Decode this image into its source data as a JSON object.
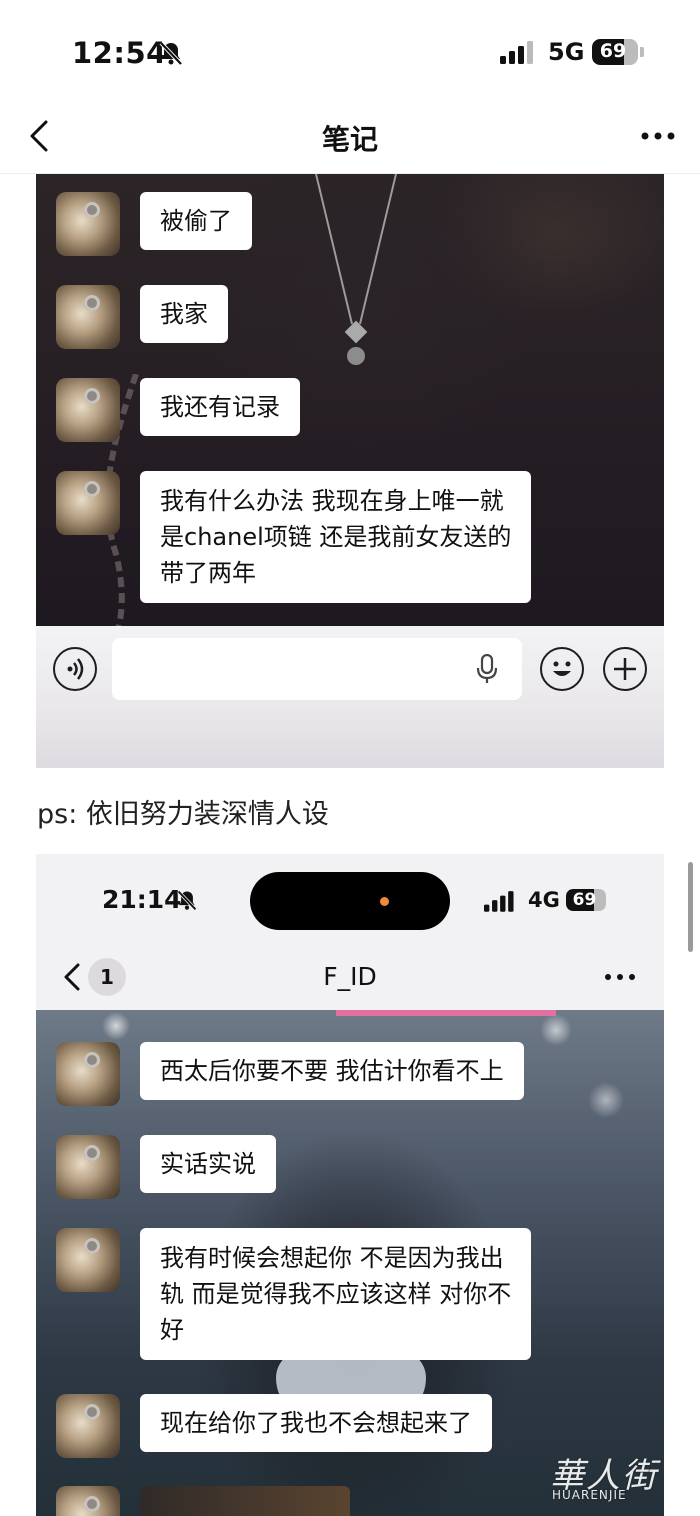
{
  "status_bar": {
    "time": "12:54",
    "network": "5G",
    "battery": "69",
    "battery_level": 0.69
  },
  "nav": {
    "title": "笔记"
  },
  "screenshot1": {
    "messages": [
      {
        "text": "被偷了"
      },
      {
        "text": "我家"
      },
      {
        "text": "我还有记录"
      },
      {
        "lines": [
          "我有什么办法 我现在身上唯一就",
          "是chanel项链 还是我前女友送的",
          "带了两年"
        ]
      }
    ]
  },
  "caption": "ps: 依旧努力装深情人设",
  "screenshot2": {
    "status": {
      "time": "21:14",
      "network": "4G",
      "battery": "69",
      "battery_level": 0.69
    },
    "nav": {
      "unread_count": "1",
      "title": "F_ID"
    },
    "messages": [
      {
        "text": "西太后你要不要 我估计你看不上"
      },
      {
        "text": "实话实说"
      },
      {
        "lines": [
          "我有时候会想起你 不是因为我出",
          "轨 而是觉得我不应该这样 对你不",
          "好"
        ]
      },
      {
        "text": "现在给你了我也不会想起来了"
      }
    ]
  },
  "watermark": {
    "cn": "華人街",
    "en": "HUARENJIE"
  },
  "icons": [
    "bell-slash-icon",
    "signal-icon",
    "battery-icon",
    "back-icon",
    "more-icon",
    "voice-icon",
    "mic-icon",
    "emoji-icon",
    "plus-icon"
  ]
}
